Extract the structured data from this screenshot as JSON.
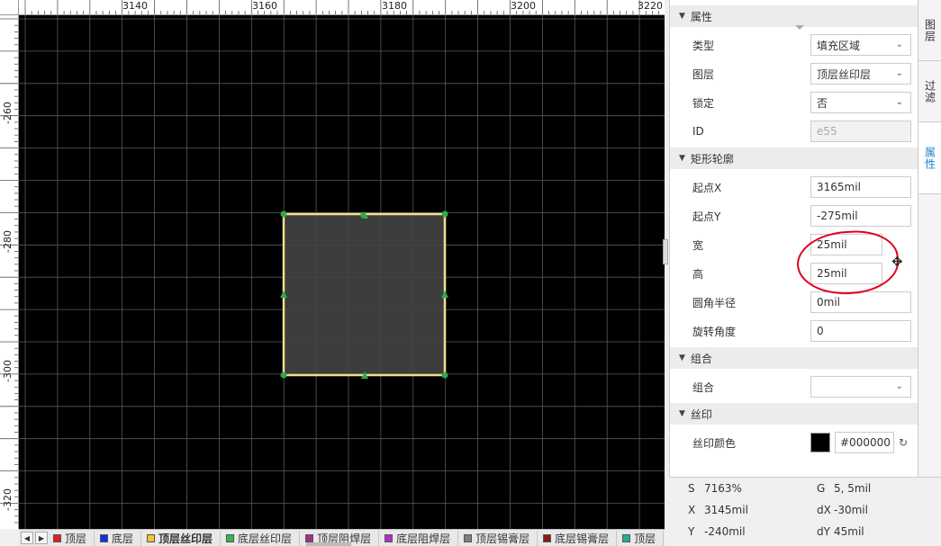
{
  "ruler": {
    "top_labels": [
      "3140",
      "3160",
      "3180",
      "3200",
      "3220"
    ],
    "left_labels": [
      "-260",
      "-280",
      "-300",
      "-320"
    ]
  },
  "panel": {
    "sections": {
      "props": "属性",
      "rect": "矩形轮廓",
      "group": "组合",
      "silk": "丝印"
    },
    "type_label": "类型",
    "type_value": "填充区域",
    "layer_label": "图层",
    "layer_value": "顶层丝印层",
    "lock_label": "锁定",
    "lock_value": "否",
    "id_label": "ID",
    "id_value": "e55",
    "startx_label": "起点X",
    "startx_value": "3165mil",
    "starty_label": "起点Y",
    "starty_value": "-275mil",
    "width_label": "宽",
    "width_value": "25mil",
    "height_label": "高",
    "height_value": "25mil",
    "radius_label": "圆角半径",
    "radius_value": "0mil",
    "rotate_label": "旋转角度",
    "rotate_value": "0",
    "group_label": "组合",
    "group_value": "",
    "silkcolor_label": "丝印颜色",
    "silkcolor_value": "#000000"
  },
  "side_tabs": [
    "图层",
    "过滤",
    "属性"
  ],
  "layers": [
    {
      "name": "顶层",
      "color": "#e02020"
    },
    {
      "name": "底层",
      "color": "#1030e0"
    },
    {
      "name": "顶层丝印层",
      "color": "#f2c531",
      "active": true
    },
    {
      "name": "底层丝印层",
      "color": "#3cb44b"
    },
    {
      "name": "顶层阻焊层",
      "color": "#a0308a"
    },
    {
      "name": "底层阻焊层",
      "color": "#b030d0"
    },
    {
      "name": "顶层锡膏层",
      "color": "#808080"
    },
    {
      "name": "底层锡膏层",
      "color": "#901818"
    },
    {
      "name": "顶层",
      "color": "#20b090"
    }
  ],
  "status": {
    "s_key": "S",
    "s_val": "7163%",
    "g_key": "G",
    "g_val": "5, 5mil",
    "x_key": "X",
    "x_val": "3145mil",
    "dx_key": "dX",
    "dx_val": "-30mil",
    "y_key": "Y",
    "y_val": "-240mil",
    "dy_key": "dY",
    "dy_val": "45mil"
  },
  "colors": {
    "canvas_bg": "#000000",
    "grid": "#5a5a5a",
    "shape_outline": "#f5de8a",
    "shape_fill": "#444444",
    "handle": "#2fa84f",
    "annotation": "#e0001a",
    "active_tab": "#1a7fd4"
  },
  "icons": {
    "cursor": "move-cursor-icon",
    "refresh": "refresh-icon",
    "dropdown": "chevron-down-icon"
  }
}
